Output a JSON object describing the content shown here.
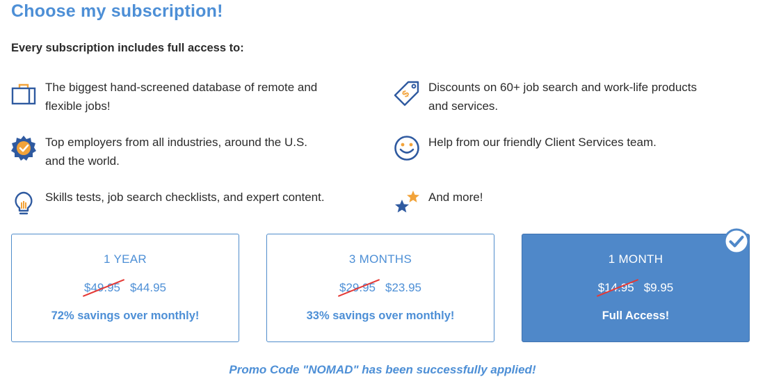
{
  "title": "Choose my subscription!",
  "subtitle": "Every subscription includes full access to:",
  "features": [
    {
      "icon": "briefcase-icon",
      "text_line1": "The biggest hand-screened database of remote and",
      "text_line2": "flexible jobs!"
    },
    {
      "icon": "price-tag-icon",
      "text_line1": "Discounts on 60+ job search and work-life products",
      "text_line2": "and services."
    },
    {
      "icon": "badge-check-icon",
      "text_line1": "Top employers from all industries, around the U.S.",
      "text_line2": "and the world."
    },
    {
      "icon": "smiley-icon",
      "text_line1": "Help from our friendly Client Services team.",
      "text_line2": ""
    },
    {
      "icon": "lightbulb-icon",
      "text_line1": "Skills tests, job search checklists, and expert content.",
      "text_line2": ""
    },
    {
      "icon": "stars-icon",
      "text_line1": "And more!",
      "text_line2": ""
    }
  ],
  "plans": [
    {
      "term": "1 YEAR",
      "old_price": "$49.95",
      "price": "$44.95",
      "note": "72% savings over monthly!",
      "selected": false
    },
    {
      "term": "3 MONTHS",
      "old_price": "$29.95",
      "price": "$23.95",
      "note": "33% savings over monthly!",
      "selected": false
    },
    {
      "term": "1 MONTH",
      "old_price": "$14.95",
      "price": "$9.95",
      "note": "Full Access!",
      "selected": true
    }
  ],
  "promo": "Promo Code \"NOMAD\" has been successfully applied!",
  "colors": {
    "accent": "#4d8fd6",
    "selected_bg": "#4f88c9",
    "strike": "#e53935",
    "icon_orange": "#f2a33a",
    "icon_navy": "#2f5aa0"
  }
}
